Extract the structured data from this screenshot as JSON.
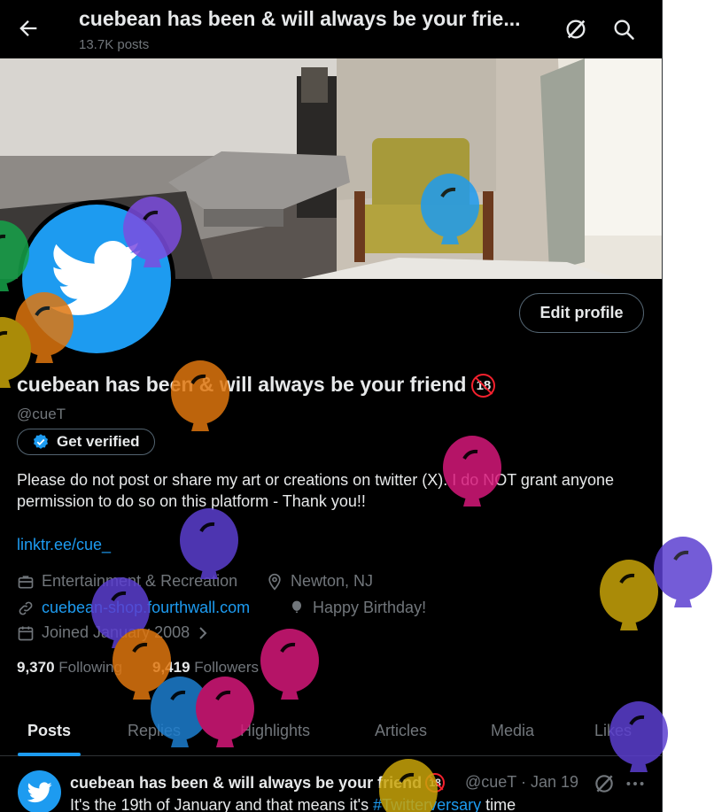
{
  "header": {
    "title": "cuebean has been & will always be your frie...",
    "posts_count": "13.7K posts"
  },
  "profile": {
    "name": "cuebean has been & will always be your friend",
    "age_badge": "18",
    "handle": "@cueT",
    "edit_label": "Edit profile",
    "verify_label": "Get verified",
    "bio": "Please do not post or share my art or creations on twitter (X). I do NOT grant anyone permission to do so on this platform - Thank you!!",
    "link": "linktr.ee/cue_",
    "category": "Entertainment & Recreation",
    "location": "Newton, NJ",
    "website": "cuebean-shop.fourthwall.com",
    "birthday": "Happy Birthday!",
    "joined": "Joined January 2008",
    "following_count": "9,370",
    "following_label": "Following",
    "followers_count": "9,419",
    "followers_label": "Followers"
  },
  "tabs": [
    {
      "label": "Posts",
      "active": true
    },
    {
      "label": "Replies"
    },
    {
      "label": "Highlights"
    },
    {
      "label": "Articles"
    },
    {
      "label": "Media"
    },
    {
      "label": "Likes"
    }
  ],
  "post": {
    "name": "cuebean has been & will always be your friend",
    "age_badge": "18",
    "meta": "@cueT · Jan 19",
    "text_before": "It's the 19th of January and that means it's ",
    "hashtag": "#Twitterversary",
    "text_after": " time"
  },
  "colors": {
    "accent": "#1d9bf0",
    "background": "#000000",
    "muted": "#71767b"
  },
  "icons": [
    "back-arrow-icon",
    "grok-icon",
    "search-icon",
    "briefcase-icon",
    "location-pin-icon",
    "link-icon",
    "balloon-icon",
    "calendar-icon",
    "chevron-right-icon",
    "verified-badge-icon",
    "more-icon",
    "twitter-bird-icon"
  ]
}
